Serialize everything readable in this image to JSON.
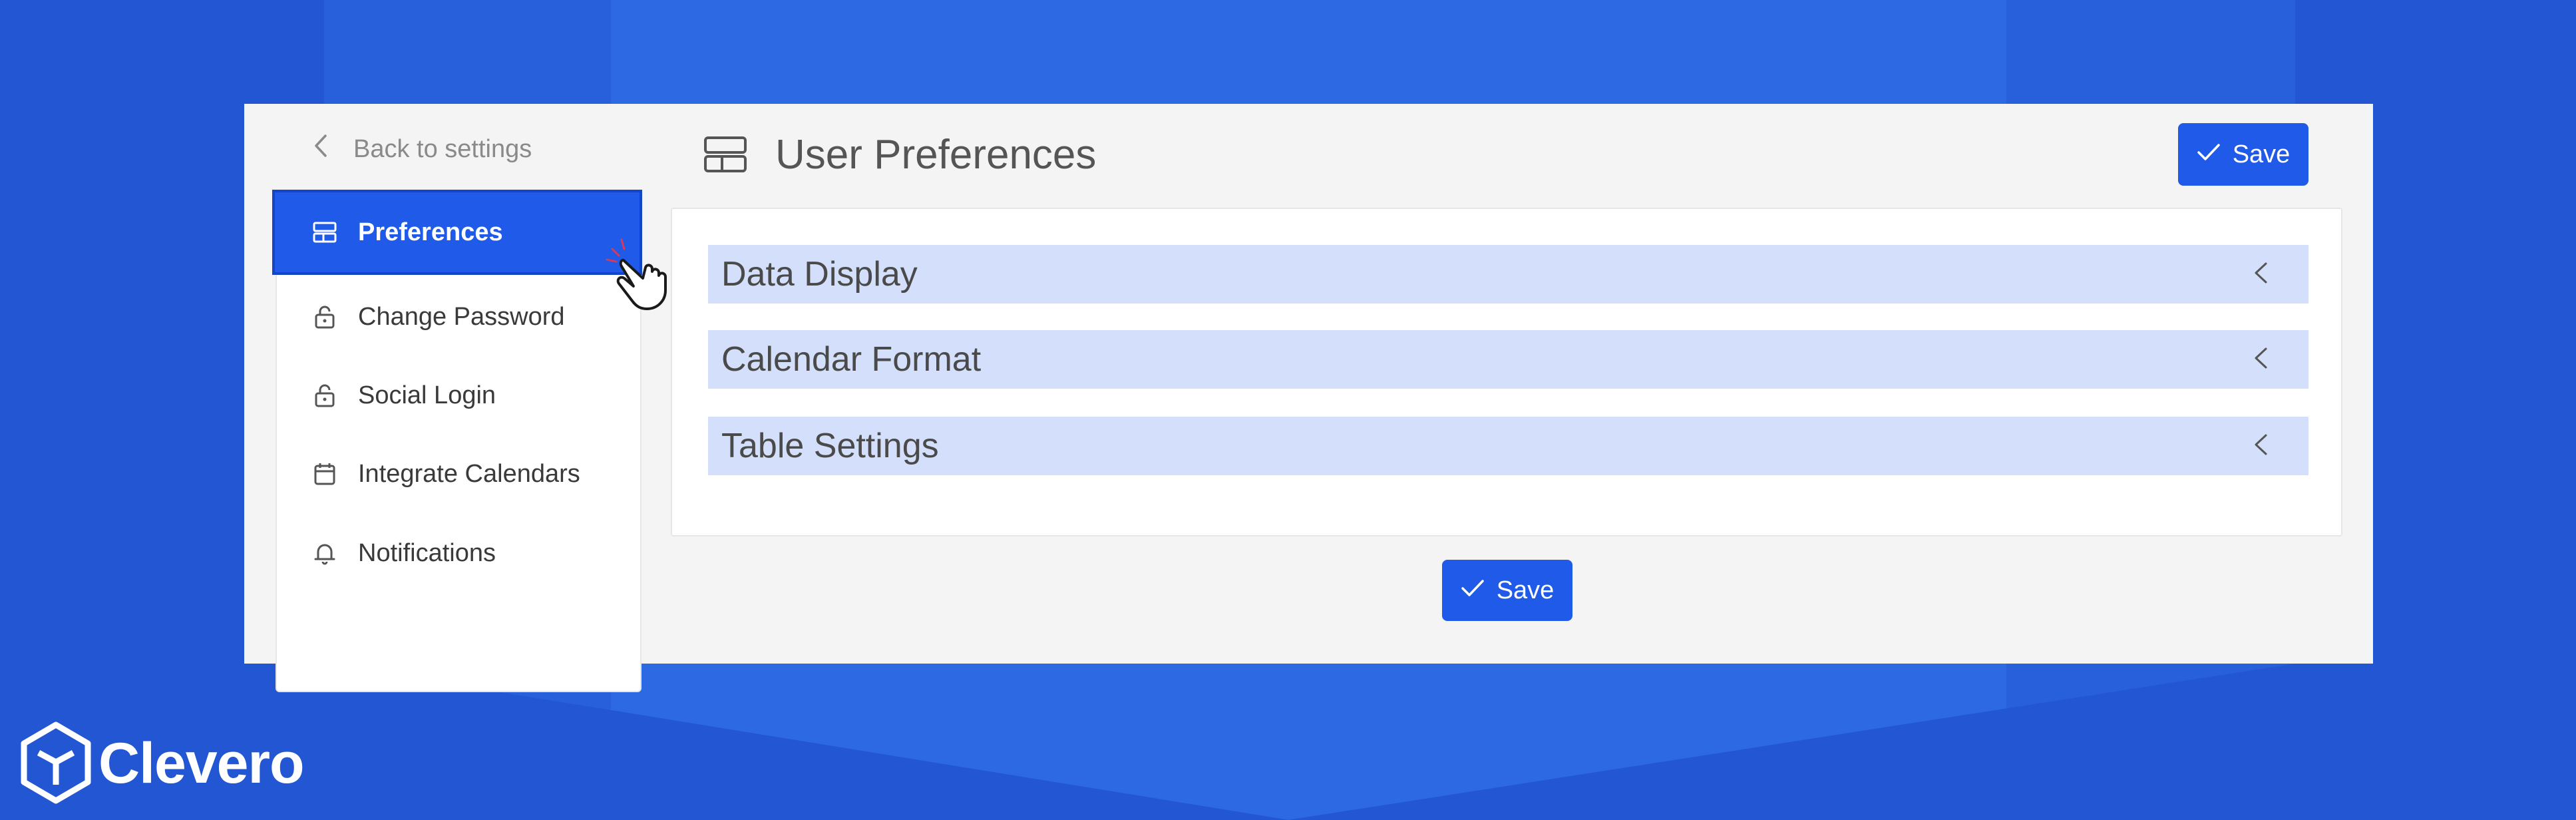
{
  "back": {
    "label": "Back to settings",
    "icon": "chevron-left-icon"
  },
  "sidebar": {
    "items": [
      {
        "label": "Preferences",
        "icon": "layout-icon",
        "active": true
      },
      {
        "label": "Change Password",
        "icon": "lock-icon"
      },
      {
        "label": "Social Login",
        "icon": "lock-icon"
      },
      {
        "label": "Integrate Calendars",
        "icon": "calendar-icon"
      },
      {
        "label": "Notifications",
        "icon": "bell-icon"
      }
    ]
  },
  "header": {
    "title": "User Preferences",
    "icon": "layout-icon"
  },
  "toolbar": {
    "save_label": "Save"
  },
  "sections": [
    {
      "label": "Data Display"
    },
    {
      "label": "Calendar Format"
    },
    {
      "label": "Table Settings"
    }
  ],
  "footer": {
    "save_label": "Save"
  },
  "brand": {
    "name": "Clevero"
  },
  "colors": {
    "background": "#2356d3",
    "accent": "#1f5ae8",
    "accordion": "#d3dffb",
    "card": "#f4f4f4"
  }
}
